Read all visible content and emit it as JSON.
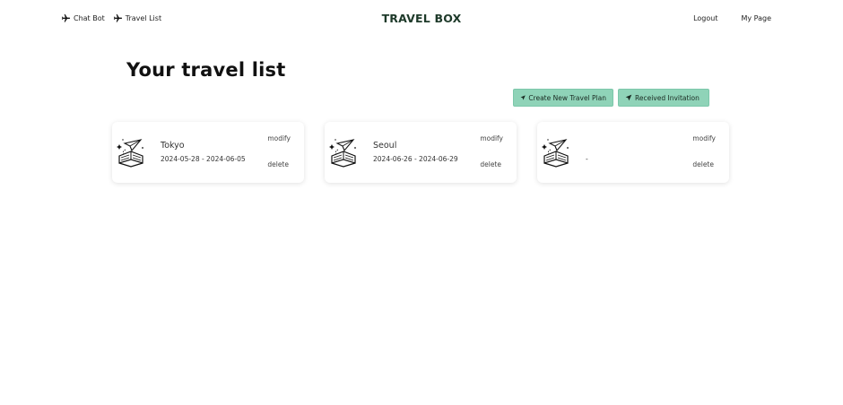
{
  "nav": {
    "chatbot_label": "Chat Bot",
    "travel_list_label": "Travel List",
    "brand": "TRAVEL BOX",
    "logout_label": "Logout",
    "mypage_label": "My Page",
    "plane_icon": "airplane-icon"
  },
  "page": {
    "title": "Your travel list"
  },
  "actions": {
    "create_label": "Create New Travel Plan",
    "invite_label": "Received Invitation",
    "icon": "send-arrow-icon",
    "button_color": "#8fd3b8"
  },
  "cards": [
    {
      "name": "Tokyo",
      "dates": "2024-05-28 - 2024-06-05",
      "modify": "modify",
      "delete": "delete"
    },
    {
      "name": "Seoul",
      "dates": "2024-06-26 - 2024-06-29",
      "modify": "modify",
      "delete": "delete"
    },
    {
      "name": "",
      "dates": "-",
      "modify": "modify",
      "delete": "delete"
    }
  ],
  "colors": {
    "brand_text": "#1e3a2a",
    "accent_button": "#8fd3b8"
  }
}
